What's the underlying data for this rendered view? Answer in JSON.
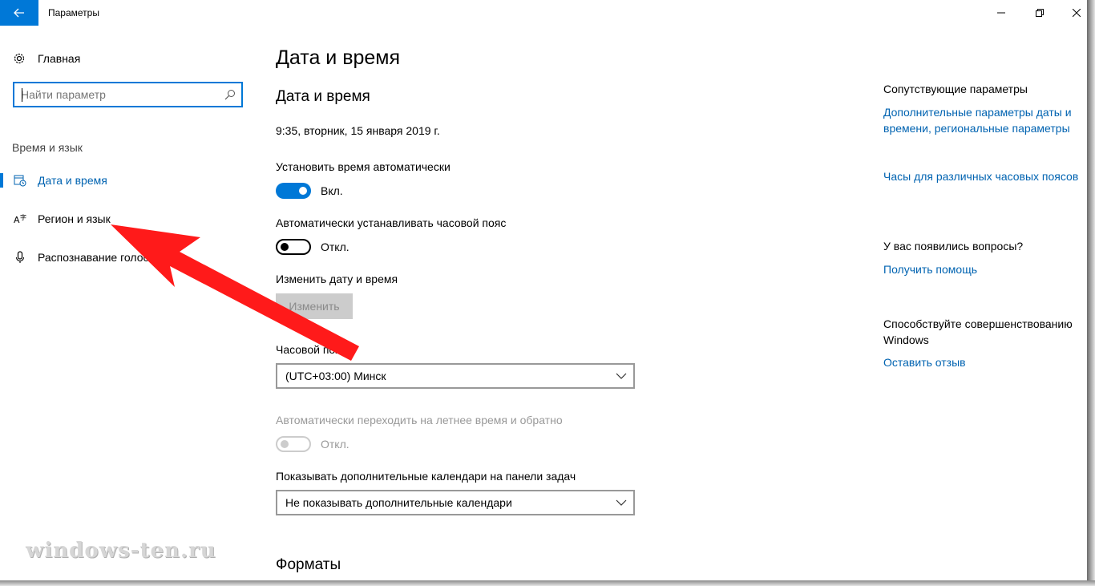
{
  "window": {
    "title": "Параметры"
  },
  "sidebar": {
    "home_label": "Главная",
    "search_placeholder": "Найти параметр",
    "section_label": "Время и язык",
    "items": [
      {
        "label": "Дата и время",
        "icon": "clock-calendar-icon",
        "active": true
      },
      {
        "label": "Регион и язык",
        "icon": "language-icon",
        "active": false
      },
      {
        "label": "Распознавание голоса",
        "icon": "microphone-icon",
        "active": false
      }
    ]
  },
  "main": {
    "page_title": "Дата и время",
    "section_title": "Дата и время",
    "current_datetime": "9:35, вторник, 15 января 2019 г.",
    "auto_time": {
      "label": "Установить время автоматически",
      "state_text": "Вкл.",
      "on": true
    },
    "auto_timezone": {
      "label": "Автоматически устанавливать часовой пояс",
      "state_text": "Откл.",
      "on": false
    },
    "change_datetime": {
      "label": "Изменить дату и время",
      "button_label": "Изменить"
    },
    "timezone": {
      "label": "Часовой пояс",
      "value": "(UTC+03:00) Минск"
    },
    "dst": {
      "label": "Автоматически переходить на летнее время и обратно",
      "state_text": "Откл.",
      "enabled": false
    },
    "calendars": {
      "label": "Показывать дополнительные календари на панели задач",
      "value": "Не показывать дополнительные календари"
    },
    "formats_title": "Форматы"
  },
  "aside": {
    "related_head": "Сопутствующие параметры",
    "related_link_1": "Дополнительные параметры даты и времени, региональные параметры",
    "related_link_2": "Часы для различных часовых поясов",
    "questions_head": "У вас появились вопросы?",
    "help_link": "Получить помощь",
    "feedback_head": "Способствуйте совершенствованию Windows",
    "feedback_link": "Оставить отзыв"
  },
  "watermark": "windows-ten.ru",
  "colors": {
    "accent": "#0078d7",
    "link": "#0063b1",
    "annotation_arrow": "#ff1a1a"
  }
}
